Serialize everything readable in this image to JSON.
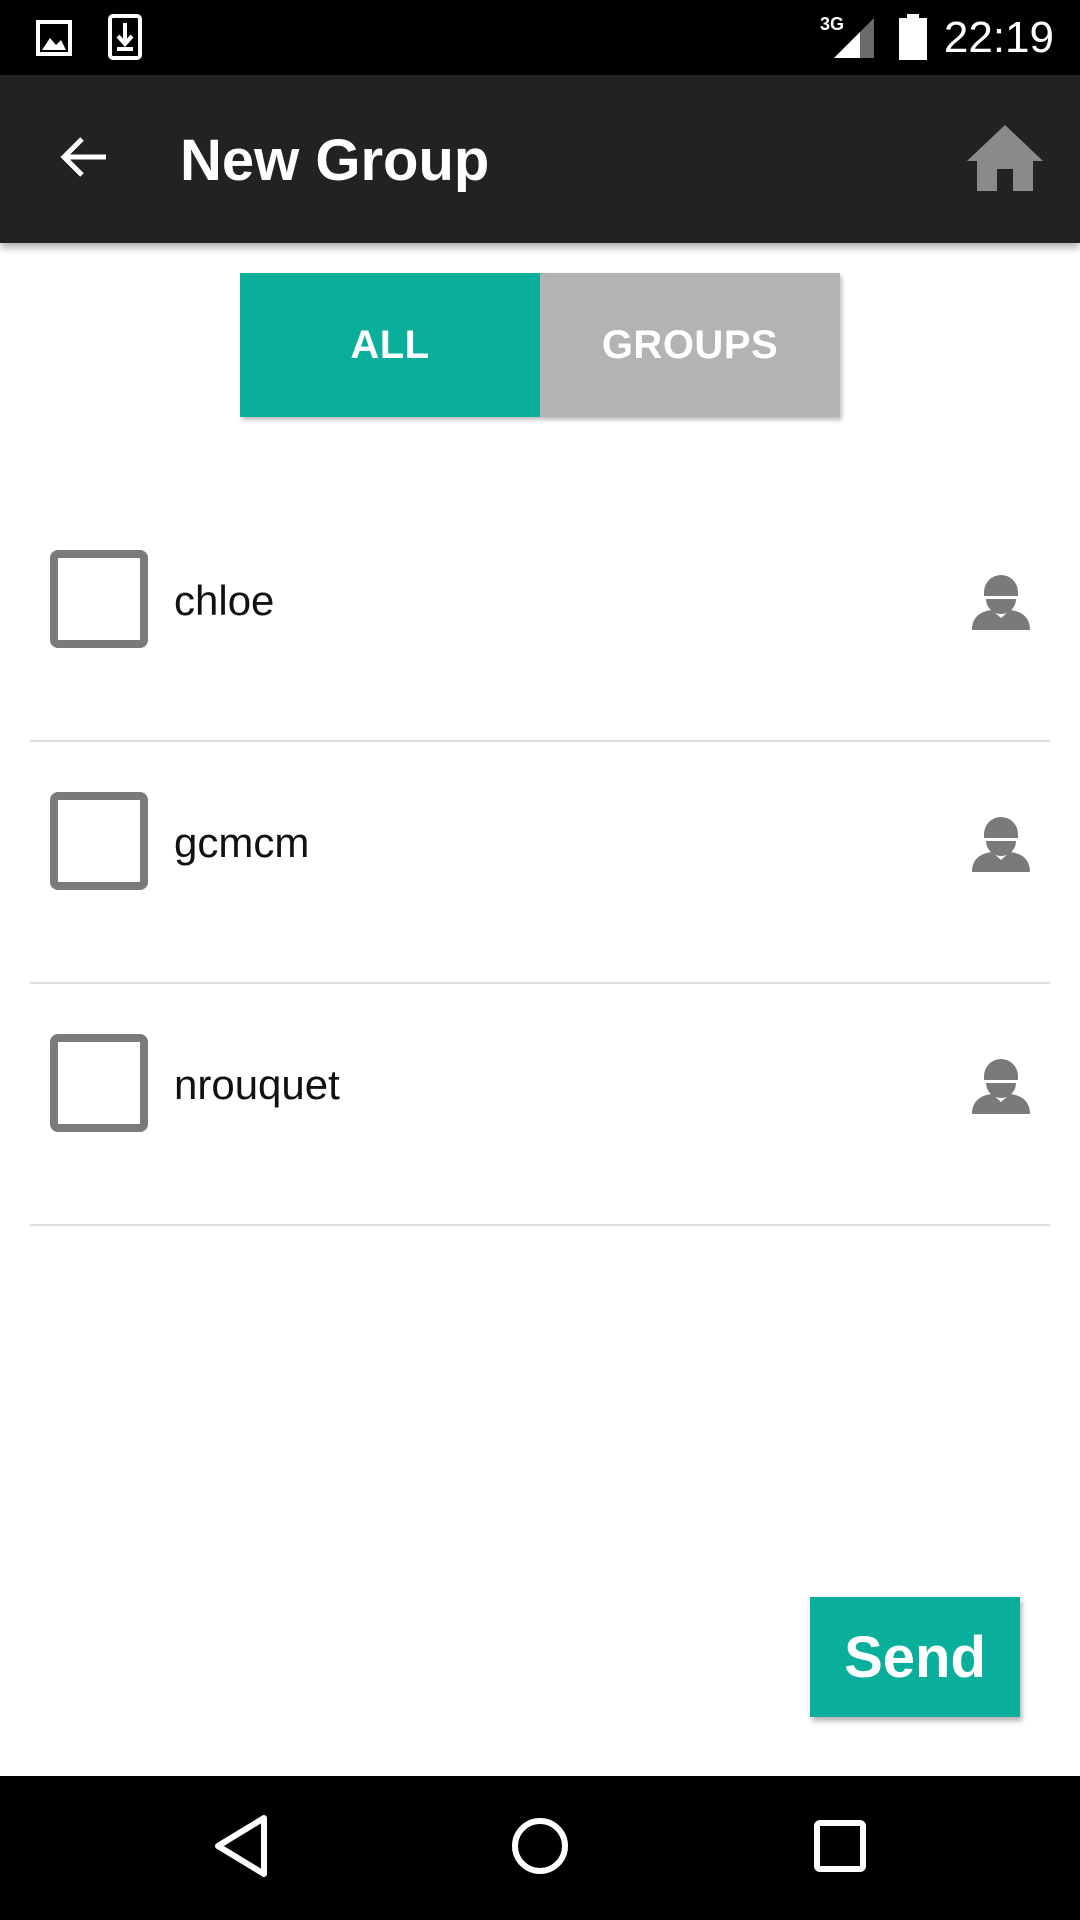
{
  "status_bar": {
    "time": "22:19",
    "network": "3G",
    "icons": [
      "image-notification-icon",
      "download-notification-icon",
      "signal-3g-icon",
      "battery-icon"
    ]
  },
  "app_bar": {
    "title": "New Group",
    "back_icon": "arrow-back-icon",
    "home_icon": "home-icon"
  },
  "tabs": [
    {
      "label": "ALL",
      "active": true
    },
    {
      "label": "GROUPS",
      "active": false
    }
  ],
  "contacts": [
    {
      "name": "chloe",
      "checked": false,
      "icon": "person-icon"
    },
    {
      "name": "gcmcm",
      "checked": false,
      "icon": "person-icon"
    },
    {
      "name": "nrouquet",
      "checked": false,
      "icon": "person-icon"
    }
  ],
  "send_button": {
    "label": "Send"
  },
  "nav_bar": {
    "icons": [
      "back-triangle-icon",
      "home-circle-icon",
      "recents-square-icon"
    ]
  },
  "colors": {
    "accent": "#0aaf9c",
    "app_bar": "#222222",
    "tab_inactive": "#b3b3b3"
  }
}
